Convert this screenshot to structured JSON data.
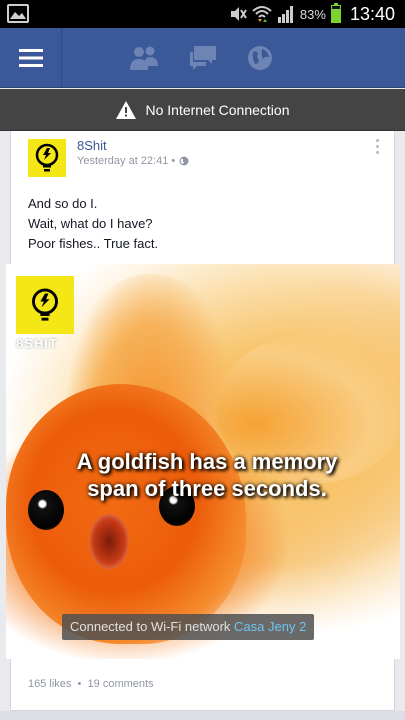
{
  "status_bar": {
    "battery_percent": "83%",
    "battery_level": 0.83,
    "time": "13:40",
    "icons": [
      "gallery-icon",
      "mute-icon",
      "wifi-icon",
      "signal-icon",
      "battery-icon"
    ]
  },
  "nav": {
    "icons": [
      "menu-icon",
      "friend-requests-icon",
      "messages-icon",
      "notifications-globe-icon"
    ],
    "brand_color": "#3b5998"
  },
  "offline_banner": {
    "text": "No Internet Connection"
  },
  "post": {
    "page_name": "8Shit",
    "timestamp": "Yesterday at 22:41 •",
    "text_lines": [
      "And so do I.",
      "Wait, what do I have?",
      "Poor fishes.. True fact."
    ],
    "image": {
      "logo_text": "8SHIT",
      "caption_line1": "A goldfish has a memory",
      "caption_line2": "span of three seconds."
    },
    "likes": "165 likes",
    "separator": "•",
    "comments": "19 comments"
  },
  "toast": {
    "prefix": "Connected to Wi-Fi network",
    "network": "Casa Jeny 2"
  }
}
